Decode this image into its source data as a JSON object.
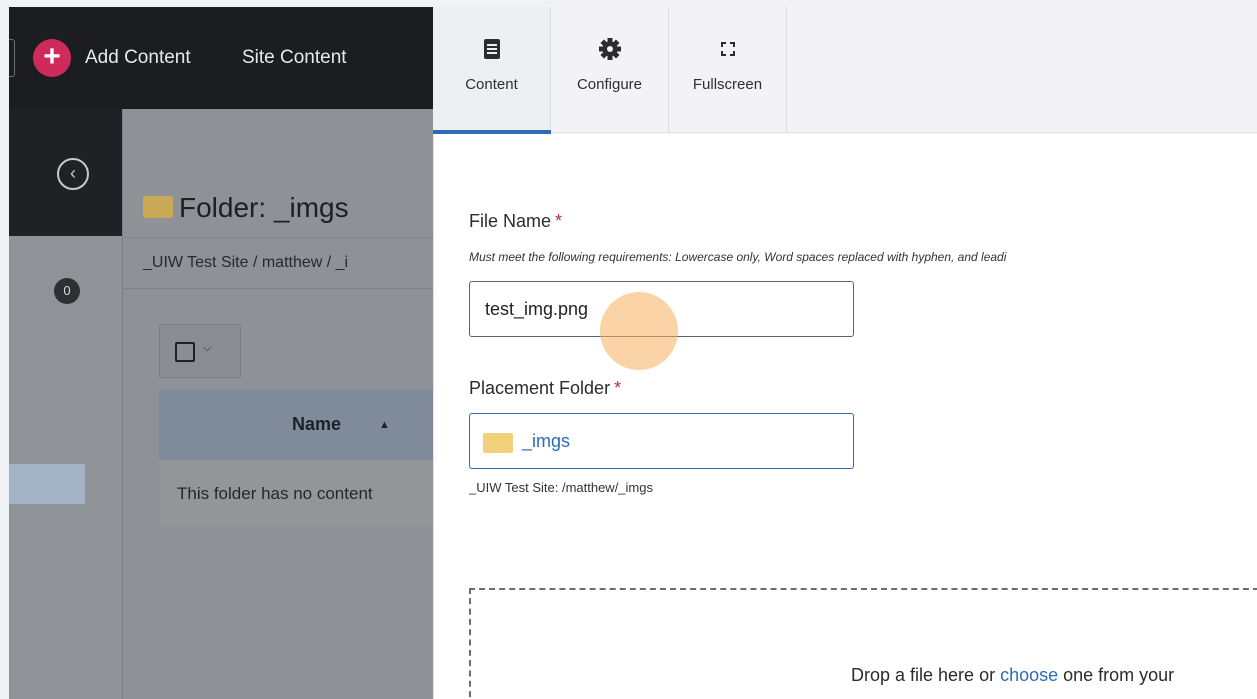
{
  "topbar": {
    "add_content": "Add Content",
    "site_content": "Site Content"
  },
  "sidebar": {
    "badge_count": "0"
  },
  "main": {
    "folder_title": "Folder: _imgs",
    "breadcrumb": "_UIW Test Site / matthew / _i",
    "table": {
      "name_header": "Name",
      "empty_message": "This folder has no content"
    }
  },
  "tabs": [
    {
      "label": "Content",
      "icon": "document-icon"
    },
    {
      "label": "Configure",
      "icon": "gear-icon"
    },
    {
      "label": "Fullscreen",
      "icon": "fullscreen-icon"
    }
  ],
  "form": {
    "file_name_label": "File Name",
    "required_mark": "*",
    "file_name_hint": "Must meet the following requirements: Lowercase only, Word spaces replaced with hyphen, and leadi",
    "file_name_value": "test_img.png",
    "placement_label": "Placement Folder",
    "placement_value": "_imgs",
    "placement_path": "_UIW Test Site: /matthew/_imgs",
    "drop_prefix": "Drop a file here or ",
    "drop_link": "choose",
    "drop_suffix": " one from your"
  },
  "colors": {
    "accent": "#2d6cb5",
    "add_button": "#cf2b5a",
    "required": "#c42b39"
  }
}
